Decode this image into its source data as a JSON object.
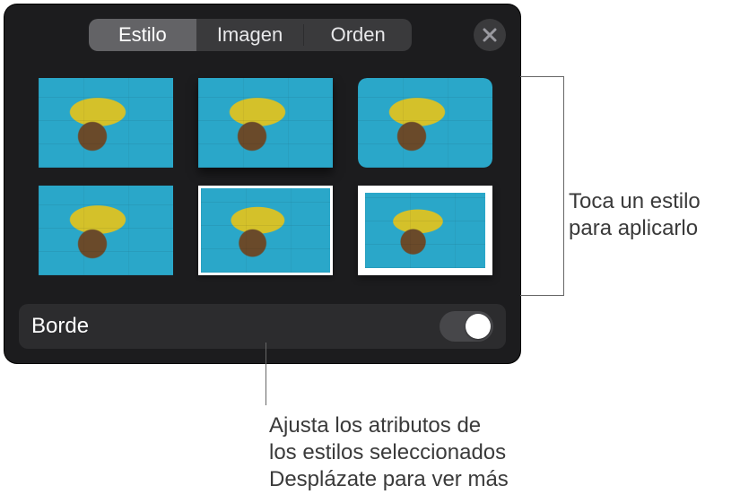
{
  "header": {
    "tabs": [
      {
        "id": "estilo",
        "label": "Estilo",
        "active": true
      },
      {
        "id": "imagen",
        "label": "Imagen",
        "active": false
      },
      {
        "id": "orden",
        "label": "Orden",
        "active": false
      }
    ],
    "close_icon": "close-icon"
  },
  "styles_grid": {
    "items": [
      {
        "id": "style-none",
        "variant": 0
      },
      {
        "id": "style-shadow",
        "variant": 1
      },
      {
        "id": "style-rounded",
        "variant": 2
      },
      {
        "id": "style-plain",
        "variant": 3
      },
      {
        "id": "style-thin-border",
        "variant": 4
      },
      {
        "id": "style-thick-border",
        "variant": 5
      }
    ]
  },
  "border_row": {
    "label": "Borde",
    "value": false
  },
  "callouts": {
    "right": "Toca un estilo para aplicarlo",
    "bottom_line1": "Ajusta los atributos de",
    "bottom_line2": "los estilos seleccionados",
    "bottom_line3": "Desplázate para ver más"
  }
}
